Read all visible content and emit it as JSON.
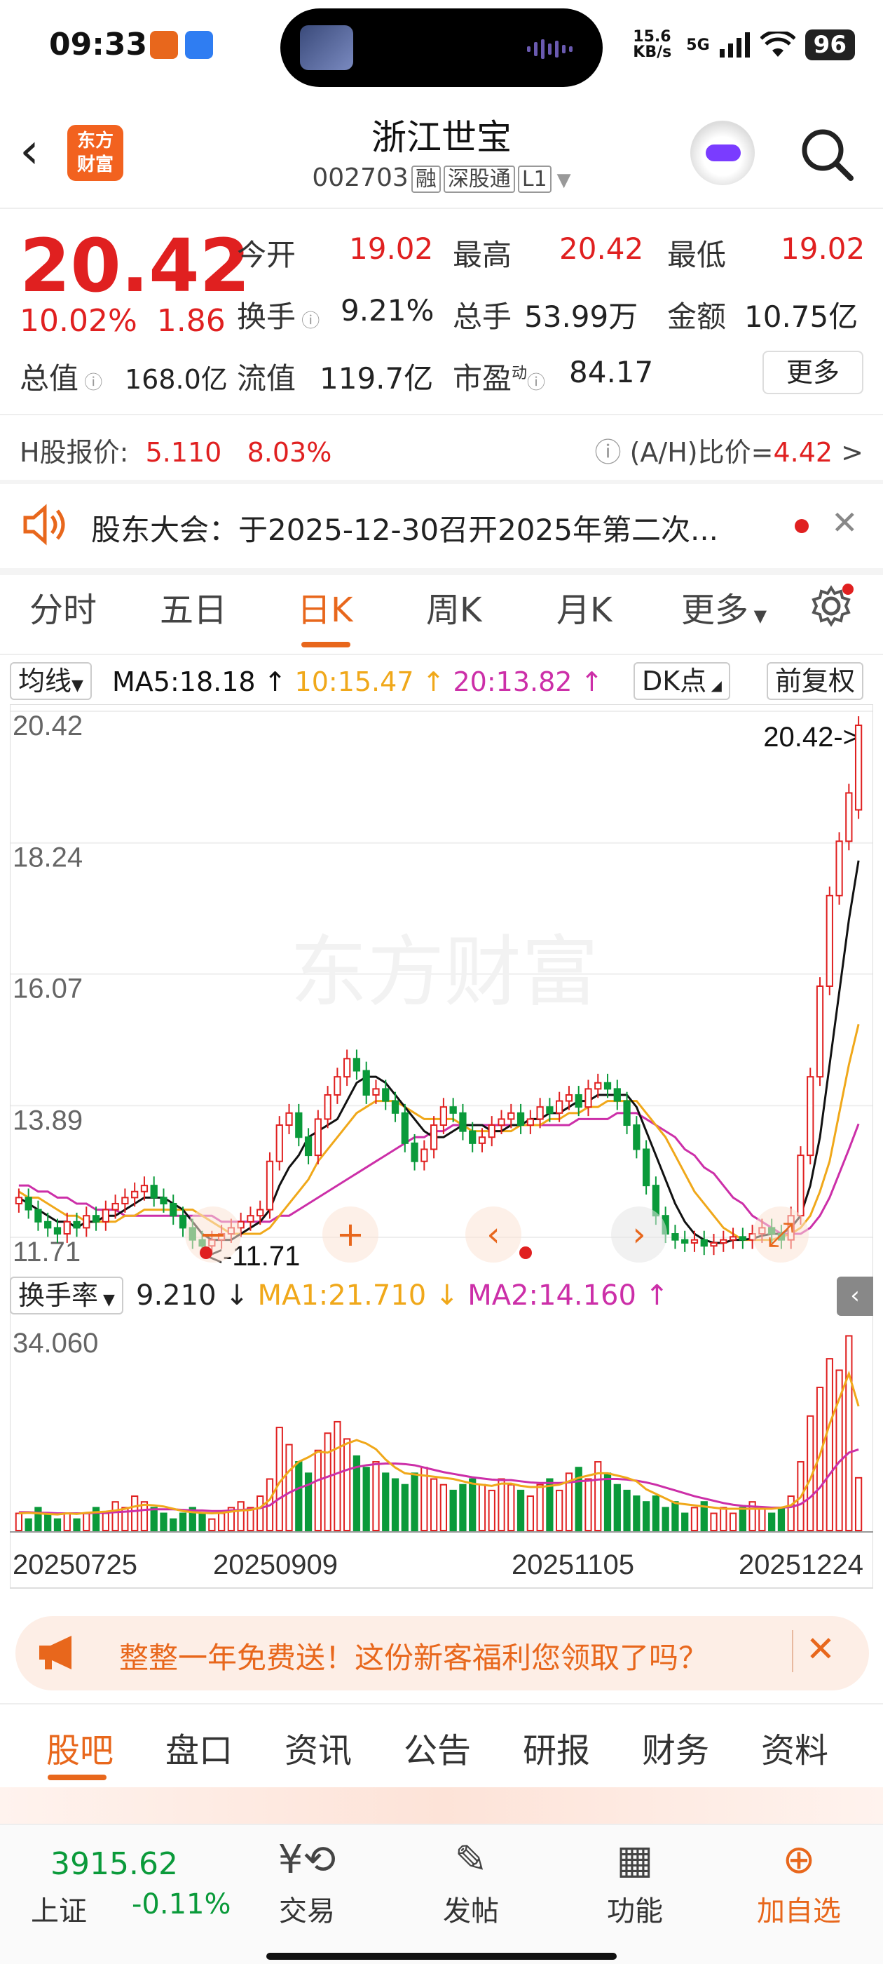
{
  "status_bar": {
    "time": "09:33",
    "net_speed": "15.6 KB/s",
    "network": "5G",
    "battery": "96"
  },
  "header": {
    "back_icon": "back-arrow-icon",
    "logo_text": "东方财富",
    "title": "浙江世宝",
    "code": "002703",
    "tags": [
      "融",
      "深股通",
      "L1"
    ]
  },
  "quote": {
    "price": "20.42",
    "change_pct": "10.02%",
    "change": "1.86",
    "open_label": "今开",
    "open": "19.02",
    "high_label": "最高",
    "high": "20.42",
    "low_label": "最低",
    "low": "19.02",
    "turnover_label": "换手",
    "turnover": "9.21%",
    "volume_label": "总手",
    "volume": "53.99万",
    "amount_label": "金额",
    "amount": "10.75亿",
    "mktcap_label": "总值",
    "mktcap": "168.0亿",
    "float_label": "流值",
    "float": "119.7亿",
    "pe_label": "市盈",
    "pe_sup": "动",
    "pe": "84.17",
    "more_button": "更多",
    "h_label": "H股报价:",
    "h_price": "5.110",
    "h_pct": "8.03%",
    "ah_label": "(A/H)比价=",
    "ah_value": "4.42",
    "ah_arrow": ">"
  },
  "notice": {
    "text": "股东大会：于2025-12-30召开2025年第二次..."
  },
  "period_tabs": [
    "分时",
    "五日",
    "日K",
    "周K",
    "月K",
    "更多"
  ],
  "period_active": "日K",
  "ma_bar": {
    "type": "均线",
    "ma5": "MA5:18.18",
    "ma10": "10:15.47",
    "ma20": "20:13.82",
    "dk": "DK点",
    "adjust": "前复权"
  },
  "vol_bar": {
    "type": "换手率",
    "value": "9.210",
    "ma1": "MA1:21.710",
    "ma2": "MA2:14.160"
  },
  "colors": {
    "up": "#e02020",
    "down": "#0a9a3a",
    "ma5": "#111111",
    "ma10": "#f0a81a",
    "ma20": "#cc2fa8",
    "accent": "#e8671c"
  },
  "chart_data": {
    "type": "candlestick",
    "y_ticks": [
      "20.42",
      "18.24",
      "16.07",
      "13.89",
      "11.71"
    ],
    "ylim": [
      11.71,
      20.42
    ],
    "last_price_label": "20.42->",
    "min_label": "<-11.71",
    "watermark": "东方财富",
    "x_labels": [
      "20250725",
      "20250909",
      "20251105",
      "20251224"
    ],
    "volume_ylabel": "34.060",
    "closes": [
      12.6,
      12.4,
      12.2,
      12.1,
      12.0,
      12.2,
      12.1,
      12.3,
      12.2,
      12.4,
      12.5,
      12.6,
      12.7,
      12.8,
      12.6,
      12.5,
      12.3,
      12.1,
      11.9,
      11.8,
      11.9,
      12.0,
      12.1,
      12.2,
      12.3,
      12.4,
      13.2,
      13.8,
      14.0,
      13.6,
      13.3,
      13.9,
      14.3,
      14.6,
      14.9,
      14.7,
      14.3,
      14.4,
      14.2,
      14.0,
      13.5,
      13.2,
      13.4,
      13.8,
      14.1,
      14.0,
      13.7,
      13.5,
      13.6,
      13.8,
      13.9,
      14.0,
      13.8,
      13.9,
      14.1,
      14.0,
      14.2,
      14.3,
      14.1,
      14.4,
      14.5,
      14.4,
      14.2,
      13.8,
      13.4,
      12.8,
      12.3,
      12.0,
      11.9,
      11.85,
      11.9,
      11.8,
      11.85,
      11.9,
      11.95,
      11.9,
      12.0,
      12.1,
      12.0,
      11.9,
      12.3,
      13.3,
      14.6,
      16.1,
      17.6,
      18.5,
      19.3,
      20.42
    ],
    "opens": [
      12.5,
      12.6,
      12.4,
      12.2,
      12.1,
      12.0,
      12.2,
      12.1,
      12.3,
      12.2,
      12.4,
      12.5,
      12.6,
      12.7,
      12.8,
      12.6,
      12.5,
      12.3,
      12.1,
      11.9,
      11.8,
      11.9,
      12.0,
      12.1,
      12.2,
      12.3,
      12.4,
      13.2,
      13.8,
      14.0,
      13.6,
      13.3,
      13.9,
      14.3,
      14.6,
      14.9,
      14.7,
      14.3,
      14.4,
      14.2,
      14.0,
      13.5,
      13.2,
      13.4,
      13.8,
      14.1,
      14.0,
      13.7,
      13.5,
      13.6,
      13.8,
      13.9,
      14.0,
      13.8,
      13.9,
      14.1,
      14.0,
      14.2,
      14.3,
      14.1,
      14.4,
      14.5,
      14.4,
      14.2,
      13.8,
      13.4,
      12.8,
      12.3,
      12.0,
      11.9,
      11.85,
      11.9,
      11.8,
      11.85,
      11.9,
      11.95,
      11.9,
      12.0,
      12.1,
      12.0,
      11.9,
      12.3,
      13.3,
      14.6,
      16.1,
      17.6,
      18.5,
      19.02
    ],
    "ma5": [
      12.6,
      12.5,
      12.4,
      12.3,
      12.2,
      12.2,
      12.1,
      12.2,
      12.2,
      12.3,
      12.3,
      12.4,
      12.5,
      12.6,
      12.6,
      12.6,
      12.5,
      12.4,
      12.2,
      12.0,
      11.9,
      11.9,
      11.9,
      12.0,
      12.1,
      12.2,
      12.4,
      12.8,
      13.1,
      13.3,
      13.6,
      13.7,
      13.8,
      13.9,
      14.2,
      14.5,
      14.6,
      14.6,
      14.5,
      14.3,
      14.1,
      13.9,
      13.7,
      13.6,
      13.6,
      13.7,
      13.8,
      13.8,
      13.8,
      13.7,
      13.7,
      13.8,
      13.8,
      13.9,
      13.9,
      14.0,
      14.0,
      14.1,
      14.2,
      14.2,
      14.3,
      14.3,
      14.3,
      14.3,
      14.1,
      13.7,
      13.3,
      12.9,
      12.5,
      12.2,
      12.0,
      11.9,
      11.85,
      11.85,
      11.9,
      11.9,
      11.92,
      11.97,
      12.0,
      12.0,
      12.1,
      12.3,
      12.8,
      13.6,
      14.8,
      16.0,
      17.2,
      18.18
    ],
    "ma10": [
      12.7,
      12.6,
      12.6,
      12.5,
      12.4,
      12.3,
      12.3,
      12.2,
      12.2,
      12.2,
      12.2,
      12.3,
      12.3,
      12.4,
      12.4,
      12.4,
      12.4,
      12.4,
      12.4,
      12.3,
      12.2,
      12.1,
      12.0,
      12.0,
      12.0,
      12.0,
      12.1,
      12.3,
      12.5,
      12.7,
      12.9,
      13.2,
      13.4,
      13.6,
      13.8,
      14.0,
      14.1,
      14.2,
      14.2,
      14.2,
      14.1,
      14.0,
      13.9,
      13.9,
      13.9,
      13.9,
      13.8,
      13.7,
      13.7,
      13.7,
      13.7,
      13.7,
      13.8,
      13.8,
      13.8,
      13.9,
      13.9,
      14.0,
      14.0,
      14.1,
      14.1,
      14.2,
      14.2,
      14.2,
      14.2,
      14.0,
      13.8,
      13.6,
      13.3,
      13.0,
      12.7,
      12.5,
      12.3,
      12.1,
      12.0,
      11.9,
      11.9,
      11.9,
      11.9,
      11.95,
      12.0,
      12.1,
      12.3,
      12.7,
      13.2,
      14.0,
      14.8,
      15.47
    ],
    "ma20": [
      12.8,
      12.8,
      12.7,
      12.7,
      12.6,
      12.6,
      12.5,
      12.5,
      12.4,
      12.4,
      12.4,
      12.3,
      12.3,
      12.3,
      12.3,
      12.3,
      12.3,
      12.3,
      12.3,
      12.3,
      12.3,
      12.2,
      12.2,
      12.2,
      12.2,
      12.2,
      12.2,
      12.3,
      12.3,
      12.4,
      12.5,
      12.6,
      12.7,
      12.8,
      12.9,
      13.0,
      13.1,
      13.2,
      13.3,
      13.4,
      13.5,
      13.6,
      13.6,
      13.7,
      13.7,
      13.8,
      13.8,
      13.8,
      13.8,
      13.8,
      13.8,
      13.8,
      13.8,
      13.8,
      13.8,
      13.8,
      13.8,
      13.8,
      13.9,
      13.9,
      13.9,
      13.9,
      14.0,
      14.0,
      14.0,
      13.9,
      13.8,
      13.7,
      13.6,
      13.4,
      13.3,
      13.1,
      13.0,
      12.8,
      12.6,
      12.5,
      12.3,
      12.2,
      12.1,
      12.0,
      12.0,
      12.0,
      12.1,
      12.3,
      12.6,
      13.0,
      13.4,
      13.82
    ],
    "turnover": [
      3,
      2,
      4,
      3,
      2,
      3,
      2,
      3,
      4,
      3,
      5,
      4,
      6,
      5,
      4,
      3,
      2,
      3,
      4,
      3,
      2,
      3,
      4,
      5,
      4,
      6,
      9,
      18,
      15,
      12,
      10,
      14,
      17,
      19,
      16,
      13,
      11,
      12,
      10,
      9,
      8,
      10,
      11,
      9,
      8,
      7,
      8,
      9,
      8,
      7,
      9,
      8,
      7,
      6,
      8,
      9,
      7,
      10,
      11,
      9,
      12,
      10,
      8,
      7,
      6,
      5,
      6,
      4,
      5,
      3,
      4,
      5,
      3,
      4,
      3,
      4,
      5,
      4,
      3,
      4,
      6,
      12,
      20,
      25,
      30,
      28,
      34,
      9.21
    ],
    "turnover_ma1": [
      3.0,
      3.1,
      3.0,
      2.9,
      2.8,
      3.0,
      2.9,
      3.1,
      3.2,
      3.3,
      3.5,
      3.8,
      4.2,
      4.5,
      4.4,
      4.2,
      3.8,
      3.4,
      3.2,
      3.1,
      3.0,
      3.1,
      3.3,
      3.5,
      3.6,
      4.0,
      5.4,
      8.4,
      10.4,
      12.0,
      12.8,
      13.8,
      13.6,
      14.4,
      15.2,
      15.8,
      15.2,
      14.2,
      12.4,
      11.0,
      10.0,
      9.8,
      9.6,
      9.4,
      9.2,
      9.0,
      8.6,
      8.2,
      8.0,
      7.8,
      8.2,
      8.2,
      7.8,
      7.6,
      7.6,
      7.8,
      8.0,
      8.6,
      9.2,
      9.6,
      10.0,
      10.0,
      9.6,
      9.2,
      8.6,
      7.2,
      6.4,
      5.6,
      4.8,
      4.6,
      4.4,
      4.2,
      4.0,
      3.8,
      3.8,
      3.8,
      3.8,
      3.8,
      3.8,
      4.0,
      4.4,
      5.8,
      9.0,
      13.2,
      18.6,
      23.0,
      27.4,
      21.71
    ],
    "turnover_ma2": [
      3.2,
      3.2,
      3.1,
      3.1,
      3.0,
      3.0,
      3.0,
      3.0,
      3.1,
      3.1,
      3.2,
      3.3,
      3.4,
      3.6,
      3.7,
      3.7,
      3.7,
      3.6,
      3.5,
      3.5,
      3.4,
      3.4,
      3.5,
      3.6,
      3.7,
      3.9,
      4.4,
      5.6,
      6.6,
      7.4,
      8.0,
      8.8,
      9.4,
      10.0,
      10.6,
      11.1,
      11.4,
      11.6,
      11.7,
      11.7,
      11.6,
      11.4,
      11.0,
      10.6,
      10.2,
      9.9,
      9.6,
      9.3,
      9.1,
      8.9,
      8.8,
      8.8,
      8.6,
      8.4,
      8.3,
      8.3,
      8.3,
      8.4,
      8.6,
      8.7,
      8.9,
      9.0,
      9.0,
      8.9,
      8.7,
      8.4,
      8.0,
      7.5,
      7.0,
      6.5,
      6.0,
      5.6,
      5.2,
      4.8,
      4.5,
      4.3,
      4.2,
      4.1,
      4.0,
      4.0,
      4.1,
      4.6,
      5.8,
      7.5,
      9.8,
      12.0,
      13.6,
      14.16
    ]
  },
  "ad": {
    "text": "整整一年免费送！这份新客福利您领取了吗？"
  },
  "bottom_tabs": [
    "股吧",
    "盘口",
    "资讯",
    "公告",
    "研报",
    "财务",
    "资料"
  ],
  "bottom_tab_active": "股吧",
  "bottom_nav": {
    "index_value": "3915.62",
    "index_name": "上证",
    "index_change": "-0.11%",
    "trade": "交易",
    "post": "发帖",
    "func": "功能",
    "add": "加自选"
  }
}
